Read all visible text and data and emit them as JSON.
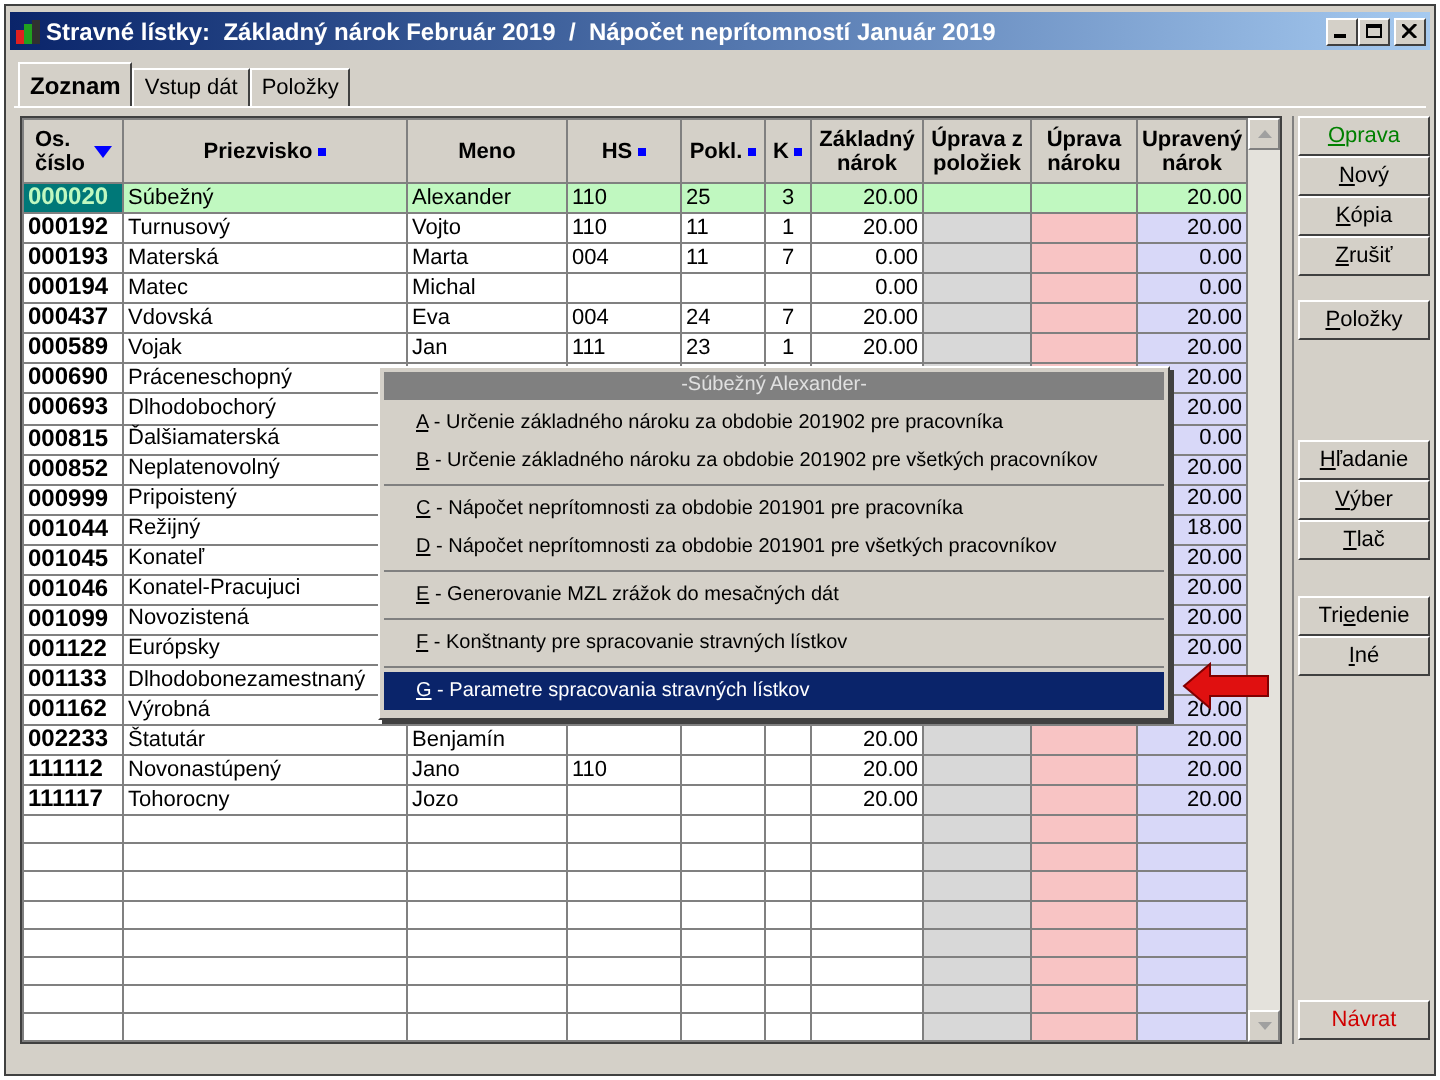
{
  "window": {
    "title": "Stravné lístky:  Základný nárok Február 2019  /  Nápočet neprítomností Január 2019"
  },
  "tabs": [
    {
      "label": "Zoznam",
      "selected": true
    },
    {
      "label": "Vstup dát",
      "selected": false
    },
    {
      "label": "Položky",
      "selected": false
    }
  ],
  "table": {
    "columns": [
      {
        "label": "Os.\nčíslo",
        "sorted_descending": true,
        "indexed": false
      },
      {
        "label": "Priezvisko",
        "sorted_descending": false,
        "indexed": true
      },
      {
        "label": "Meno",
        "sorted_descending": false,
        "indexed": false
      },
      {
        "label": "HS",
        "sorted_descending": false,
        "indexed": true
      },
      {
        "label": "Pokl.",
        "sorted_descending": false,
        "indexed": true
      },
      {
        "label": "K",
        "sorted_descending": false,
        "indexed": true
      },
      {
        "label": "Základný\nnárok",
        "sorted_descending": false,
        "indexed": false
      },
      {
        "label": "Úprava z\npoložiek",
        "sorted_descending": false,
        "indexed": false
      },
      {
        "label": "Úprava\nnároku",
        "sorted_descending": false,
        "indexed": false
      },
      {
        "label": "Upravený\nnárok",
        "sorted_descending": false,
        "indexed": false
      }
    ],
    "rows": [
      {
        "selected": true,
        "id": "000020",
        "surname": "Súbežný",
        "name": "Alexander",
        "hs": "110",
        "pokl": "25",
        "k": "3",
        "base": "20.00",
        "adjusted": "20.00"
      },
      {
        "selected": false,
        "id": "000192",
        "surname": "Turnusový",
        "name": "Vojto",
        "hs": "110",
        "pokl": "11",
        "k": "1",
        "base": "20.00",
        "adjusted": "20.00"
      },
      {
        "selected": false,
        "id": "000193",
        "surname": "Materská",
        "name": "Marta",
        "hs": "004",
        "pokl": "11",
        "k": "7",
        "base": "0.00",
        "adjusted": "0.00"
      },
      {
        "selected": false,
        "id": "000194",
        "surname": "Matec",
        "name": "Michal",
        "base": "0.00",
        "adjusted": "0.00"
      },
      {
        "selected": false,
        "id": "000437",
        "surname": "Vdovská",
        "name": "Eva",
        "hs": "004",
        "pokl": "24",
        "k": "7",
        "base": "20.00",
        "adjusted": "20.00"
      },
      {
        "selected": false,
        "id": "000589",
        "surname": "Vojak",
        "name": "Jan",
        "hs": "111",
        "pokl": "23",
        "k": "1",
        "base": "20.00",
        "adjusted": "20.00"
      },
      {
        "selected": false,
        "id": "000690",
        "surname": "Práceneschopný",
        "adjusted": "20.00"
      },
      {
        "selected": false,
        "id": "000693",
        "surname": "Dlhodobochorý",
        "adjusted": "20.00"
      },
      {
        "selected": false,
        "id": "000815",
        "surname": "Ďalšiamaterská",
        "adjusted": "0.00"
      },
      {
        "selected": false,
        "id": "000852",
        "surname": "Neplatenovolný",
        "adjusted": "20.00"
      },
      {
        "selected": false,
        "id": "000999",
        "surname": "Pripoistený",
        "adjusted": "20.00"
      },
      {
        "selected": false,
        "id": "001044",
        "surname": "Režijný",
        "adjusted": "18.00"
      },
      {
        "selected": false,
        "id": "001045",
        "surname": "Konateľ",
        "adjusted": "20.00"
      },
      {
        "selected": false,
        "id": "001046",
        "surname": "Konatel-Pracujuci",
        "adjusted": "20.00"
      },
      {
        "selected": false,
        "id": "001099",
        "surname": "Novozistená",
        "adjusted": "20.00"
      },
      {
        "selected": false,
        "id": "001122",
        "surname": "Európsky",
        "adjusted": "20.00"
      },
      {
        "selected": false,
        "id": "001133",
        "surname": "Dlhodobonezamestnaný"
      },
      {
        "selected": false,
        "id": "001162",
        "surname": "Výrobná",
        "adjusted": "20.00"
      },
      {
        "selected": false,
        "id": "002233",
        "surname": "Štatutár",
        "name": "Benjamín",
        "base": "20.00",
        "adjusted": "20.00"
      },
      {
        "selected": false,
        "id": "111112",
        "surname": "Novonastúpený",
        "name": "Jano",
        "hs": "110",
        "base": "20.00",
        "adjusted": "20.00"
      },
      {
        "selected": false,
        "id": "111117",
        "surname": "Tohorocny",
        "name": "Jozo",
        "base": "20.00",
        "adjusted": "20.00"
      }
    ]
  },
  "context_menu": {
    "title": "-Súbežný Alexander-",
    "groups": [
      [
        {
          "key": "A",
          "label": " - Určenie základného nároku za obdobie 201902 pre pracovníka",
          "selected": false
        },
        {
          "key": "B",
          "label": " - Určenie základného nároku za obdobie 201902 pre všetkých pracovníkov",
          "selected": false
        }
      ],
      [
        {
          "key": "C",
          "label": " - Nápočet neprítomnosti za obdobie 201901 pre pracovníka",
          "selected": false
        },
        {
          "key": "D",
          "label": " - Nápočet neprítomnosti za obdobie 201901 pre všetkých pracovníkov",
          "selected": false
        }
      ],
      [
        {
          "key": "E",
          "label": " - Generovanie MZL zrážok do mesačných dát",
          "selected": false
        }
      ],
      [
        {
          "key": "F",
          "label": " - Konštnanty pre spracovanie stravných lístkov",
          "selected": false
        }
      ],
      [
        {
          "key": "G",
          "label": " - Parametre spracovania stravných lístkov",
          "selected": true
        }
      ]
    ]
  },
  "buttons": [
    [
      {
        "key": "O",
        "post": "prava",
        "kind": "primary"
      },
      {
        "key": "N",
        "post": "ový",
        "kind": "normal"
      },
      {
        "key": "K",
        "post": "ópia",
        "kind": "normal"
      },
      {
        "key": "Z",
        "post": "rušiť",
        "kind": "normal"
      }
    ],
    [
      {
        "key": "P",
        "post": "oložky",
        "kind": "normal"
      }
    ],
    [
      {
        "key": "H",
        "post": "ľadanie",
        "kind": "normal"
      },
      {
        "key": "V",
        "post": "ýber",
        "kind": "normal"
      },
      {
        "key": "T",
        "post": "lač",
        "kind": "normal"
      }
    ],
    [
      {
        "pre": "Tri",
        "key": "e",
        "post": "denie",
        "kind": "normal"
      },
      {
        "key": "I",
        "post": "né",
        "kind": "normal"
      }
    ],
    [
      {
        "pre": "Návrat",
        "kind": "exit"
      }
    ]
  ]
}
